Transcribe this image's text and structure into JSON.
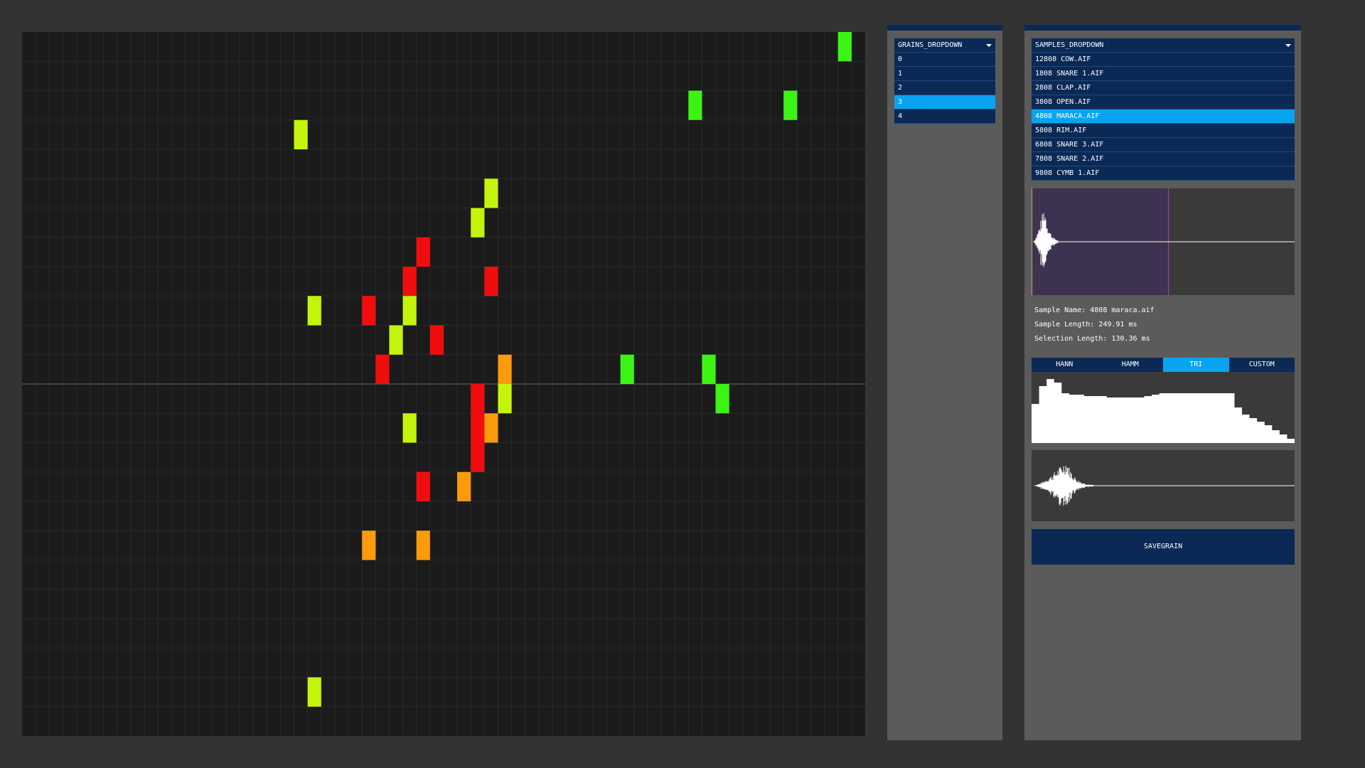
{
  "grid": {
    "cols": 62,
    "rows": 24,
    "colors": {
      "green": "#3cf413",
      "yellow": "#c5f40c",
      "red": "#f10d0d",
      "orange": "#fb9a0b",
      "background": "#1b1b1b",
      "gridline": "#2a2a2a",
      "center_line": "#666666"
    },
    "cells": [
      {
        "col": 60,
        "row": 0,
        "color": "green"
      },
      {
        "col": 49,
        "row": 2,
        "color": "green"
      },
      {
        "col": 56,
        "row": 2,
        "color": "green"
      },
      {
        "col": 20,
        "row": 3,
        "color": "yellow"
      },
      {
        "col": 34,
        "row": 5,
        "color": "yellow"
      },
      {
        "col": 33,
        "row": 6,
        "color": "yellow"
      },
      {
        "col": 29,
        "row": 7,
        "color": "red"
      },
      {
        "col": 28,
        "row": 8,
        "color": "red"
      },
      {
        "col": 34,
        "row": 8,
        "color": "red"
      },
      {
        "col": 21,
        "row": 9,
        "color": "yellow"
      },
      {
        "col": 25,
        "row": 9,
        "color": "red"
      },
      {
        "col": 28,
        "row": 9,
        "color": "yellow"
      },
      {
        "col": 27,
        "row": 10,
        "color": "yellow"
      },
      {
        "col": 30,
        "row": 10,
        "color": "red"
      },
      {
        "col": 26,
        "row": 11,
        "color": "red"
      },
      {
        "col": 35,
        "row": 11,
        "color": "orange"
      },
      {
        "col": 44,
        "row": 11,
        "color": "green"
      },
      {
        "col": 50,
        "row": 11,
        "color": "green"
      },
      {
        "col": 33,
        "row": 12,
        "color": "red"
      },
      {
        "col": 35,
        "row": 12,
        "color": "yellow"
      },
      {
        "col": 51,
        "row": 12,
        "color": "green"
      },
      {
        "col": 28,
        "row": 13,
        "color": "yellow"
      },
      {
        "col": 33,
        "row": 13,
        "color": "red"
      },
      {
        "col": 34,
        "row": 13,
        "color": "orange"
      },
      {
        "col": 33,
        "row": 14,
        "color": "red"
      },
      {
        "col": 29,
        "row": 15,
        "color": "red"
      },
      {
        "col": 32,
        "row": 15,
        "color": "orange"
      },
      {
        "col": 25,
        "row": 17,
        "color": "orange"
      },
      {
        "col": 29,
        "row": 17,
        "color": "orange"
      },
      {
        "col": 21,
        "row": 22,
        "color": "yellow"
      }
    ]
  },
  "grains_dropdown": {
    "header": "GRAINS_DROPDOWN",
    "items": [
      "0",
      "1",
      "2",
      "3",
      "4"
    ],
    "selected_index": 3
  },
  "samples_dropdown": {
    "header": "SAMPLES_DROPDOWN",
    "items": [
      "12808 COW.AIF",
      "1808 SNARE 1.AIF",
      "2808 CLAP.AIF",
      "3808 OPEN.AIF",
      "4808 MARACA.AIF",
      "5808 RIM.AIF",
      "6808 SNARE 3.AIF",
      "7808 SNARE 2.AIF",
      "9808 CYMB 1.AIF"
    ],
    "selected_index": 4
  },
  "sample_info": {
    "name_line": "Sample Name: 4808 maraca.aif",
    "length_line": "Sample Length: 249.91 ms",
    "selection_line": "Selection Length: 130.36 ms"
  },
  "sample_view": {
    "selection_fraction": 0.52,
    "selection_color": "#3d3250",
    "selection_edge_color": "#b03cc8"
  },
  "window_tabs": {
    "items": [
      "HANN",
      "HAMM",
      "TRI",
      "CUSTOM"
    ],
    "selected_index": 2
  },
  "window_shape": {
    "levels": [
      0.55,
      0.8,
      0.9,
      0.85,
      0.7,
      0.68,
      0.68,
      0.66,
      0.66,
      0.66,
      0.64,
      0.64,
      0.64,
      0.64,
      0.64,
      0.66,
      0.68,
      0.7,
      0.7,
      0.7,
      0.7,
      0.7,
      0.7,
      0.7,
      0.7,
      0.7,
      0.7,
      0.5,
      0.4,
      0.35,
      0.3,
      0.25,
      0.18,
      0.12,
      0.06
    ]
  },
  "save_button": {
    "label": "SAVEGRAIN"
  }
}
